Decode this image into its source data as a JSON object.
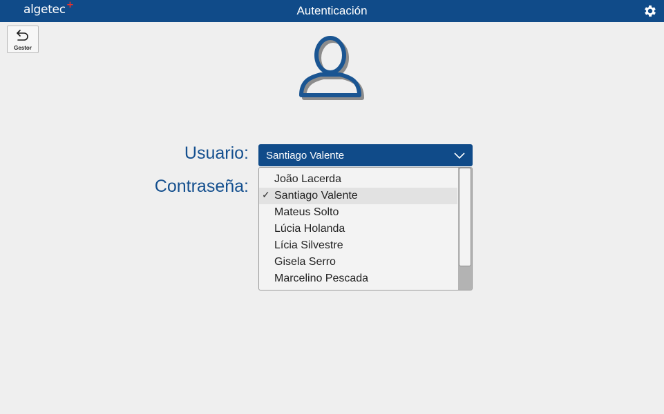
{
  "header": {
    "brand": "algetec",
    "brand_plus": "+",
    "title": "Autenticación",
    "settings_icon": "gear-icon"
  },
  "back_button": {
    "label": "Gestor",
    "icon": "undo-arrow-icon"
  },
  "avatar": {
    "icon": "user-silhouette-icon"
  },
  "form": {
    "user_label": "Usuario:",
    "password_label": "Contraseña:",
    "selected_user": "Santiago Valente",
    "options": [
      "João Lacerda",
      "Santiago Valente",
      "Mateus Solto",
      "Lúcia Holanda",
      "Lícia Silvestre",
      "Gisela Serro",
      "Marcelino Pescada"
    ],
    "selected_index": 1,
    "check_mark": "✓"
  },
  "colors": {
    "header_bg": "#104b89",
    "label_text": "#15508f",
    "brand_plus": "#e8322d",
    "background": "#efefef"
  }
}
